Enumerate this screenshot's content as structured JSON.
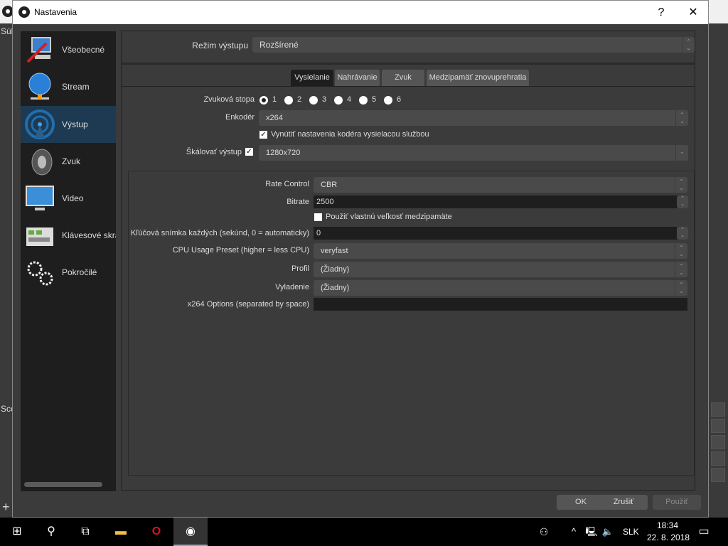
{
  "background": {
    "menu_fragment": "Súl",
    "scenes_fragment": "Sce"
  },
  "dialog": {
    "title": "Nastavenia",
    "help": "?",
    "close": "✕"
  },
  "sidebar": {
    "items": [
      {
        "label": "Všeobecné",
        "icon": "general-icon"
      },
      {
        "label": "Stream",
        "icon": "globe-icon"
      },
      {
        "label": "Výstup",
        "icon": "broadcast-icon"
      },
      {
        "label": "Zvuk",
        "icon": "speaker-icon"
      },
      {
        "label": "Video",
        "icon": "monitor-icon"
      },
      {
        "label": "Klávesové skratky",
        "icon": "keyboard-icon"
      },
      {
        "label": "Pokročilé",
        "icon": "gears-icon"
      }
    ],
    "selected": "Výstup"
  },
  "output_mode": {
    "label": "Režim výstupu",
    "value": "Rozšírené"
  },
  "tabs": [
    {
      "label": "Vysielanie"
    },
    {
      "label": "Nahrávanie"
    },
    {
      "label": "Zvuk"
    },
    {
      "label": "Medzipamäť znovuprehratia"
    }
  ],
  "streaming": {
    "audio_track_label": "Zvuková stopa",
    "audio_tracks": [
      "1",
      "2",
      "3",
      "4",
      "5",
      "6"
    ],
    "audio_track_selected": "1",
    "encoder_label": "Enkodér",
    "encoder": "x264",
    "enforce_label": "Vynútiť nastavenia kodéra vysielacou službou",
    "enforce_checked": true,
    "rescale_label": "Škálovať výstup",
    "rescale_checked": true,
    "rescale_value": "1280x720",
    "rate_control_label": "Rate Control",
    "rate_control": "CBR",
    "bitrate_label": "Bitrate",
    "bitrate": "2500",
    "custom_buffer_label": "Použiť vlastnú veľkosť medzipamäte",
    "custom_buffer_checked": false,
    "keyframe_label": "Kľúčová snímka každých (sekúnd, 0 = automaticky)",
    "keyframe": "0",
    "preset_label": "CPU Usage Preset (higher = less CPU)",
    "preset": "veryfast",
    "profile_label": "Profil",
    "profile": "(Žiadny)",
    "tune_label": "Vyladenie",
    "tune": "(Žiadny)",
    "options_label": "x264 Options (separated by space)",
    "options": ""
  },
  "buttons": {
    "ok": "OK",
    "cancel": "Zrušiť",
    "apply": "Použiť"
  },
  "taskbar": {
    "lang": "SLK",
    "time": "18:34",
    "date": "22. 8. 2018"
  }
}
